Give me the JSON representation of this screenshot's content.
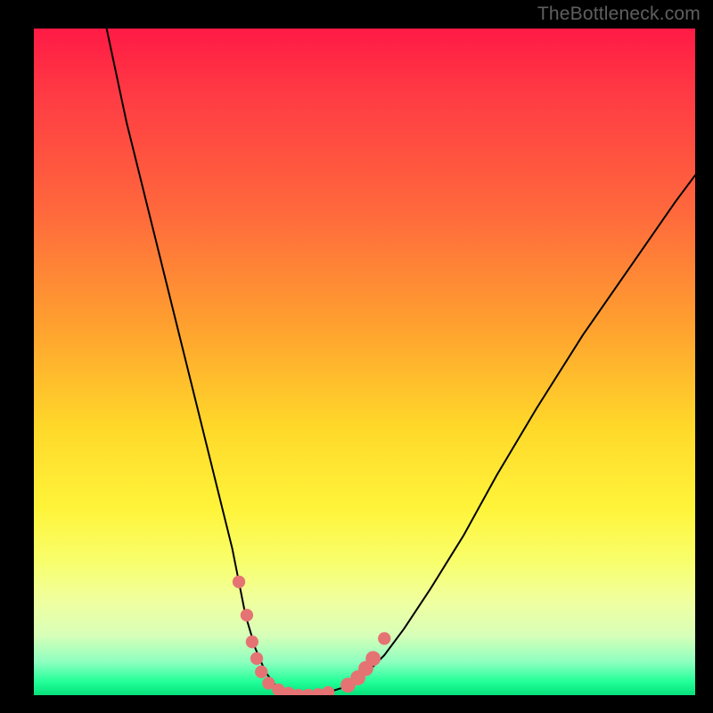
{
  "watermark": {
    "text": "TheBottleneck.com"
  },
  "colors": {
    "background": "#000000",
    "curve": "#000000",
    "marker_fill": "#e57373",
    "marker_stroke": "#cf5b5b",
    "gradient_top": "#ff1a45",
    "gradient_bottom": "#07e07a"
  },
  "chart_data": {
    "type": "line",
    "title": "",
    "xlabel": "",
    "ylabel": "",
    "xlim": [
      0,
      100
    ],
    "ylim": [
      0,
      100
    ],
    "grid": false,
    "legend": false,
    "series": [
      {
        "name": "bottleneck-curve",
        "x": [
          11,
          14,
          18,
          22,
          24,
          26,
          28,
          30,
          31,
          32,
          33.5,
          35,
          36.5,
          38,
          40,
          42,
          44,
          47,
          50,
          53,
          56,
          60,
          65,
          70,
          76,
          83,
          90,
          97,
          100
        ],
        "y": [
          100,
          86,
          70,
          54,
          46,
          38,
          30,
          22,
          17,
          12,
          7,
          3.5,
          1.5,
          0.5,
          0,
          0,
          0.3,
          1.2,
          3,
          6,
          10,
          16,
          24,
          33,
          43,
          54,
          64,
          74,
          78
        ]
      }
    ],
    "markers": [
      {
        "x": 31.0,
        "y": 17.0,
        "r": 1.7
      },
      {
        "x": 32.2,
        "y": 12.0,
        "r": 1.7
      },
      {
        "x": 33.0,
        "y": 8.0,
        "r": 1.7
      },
      {
        "x": 33.7,
        "y": 5.5,
        "r": 1.7
      },
      {
        "x": 34.4,
        "y": 3.5,
        "r": 1.7
      },
      {
        "x": 35.5,
        "y": 1.8,
        "r": 1.7
      },
      {
        "x": 37.0,
        "y": 0.8,
        "r": 1.7
      },
      {
        "x": 38.5,
        "y": 0.3,
        "r": 1.7
      },
      {
        "x": 40.0,
        "y": 0.0,
        "r": 1.7
      },
      {
        "x": 41.5,
        "y": 0.0,
        "r": 1.7
      },
      {
        "x": 43.0,
        "y": 0.1,
        "r": 1.7
      },
      {
        "x": 44.5,
        "y": 0.4,
        "r": 1.7
      },
      {
        "x": 47.5,
        "y": 1.5,
        "r": 2.0
      },
      {
        "x": 49.0,
        "y": 2.6,
        "r": 2.0
      },
      {
        "x": 50.2,
        "y": 4.0,
        "r": 2.0
      },
      {
        "x": 51.3,
        "y": 5.5,
        "r": 2.0
      },
      {
        "x": 53.0,
        "y": 8.5,
        "r": 1.7
      }
    ]
  }
}
